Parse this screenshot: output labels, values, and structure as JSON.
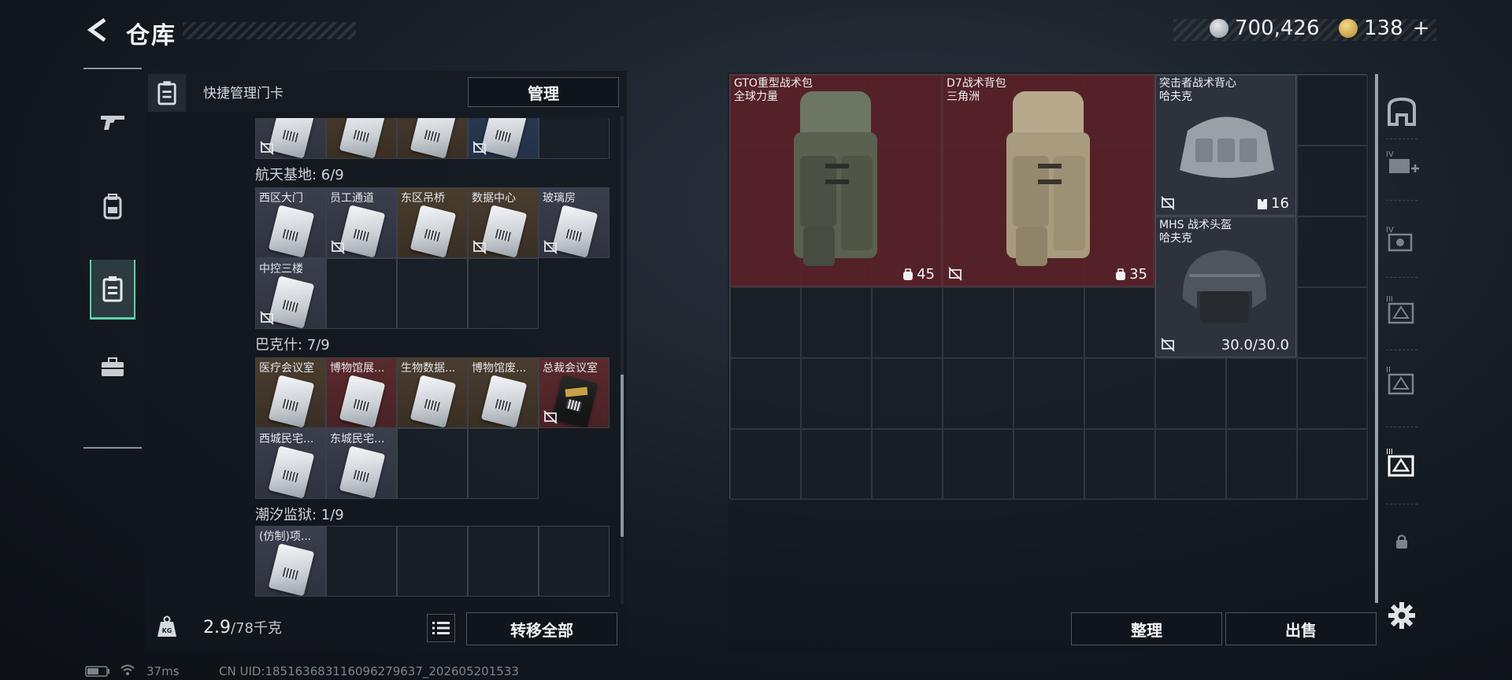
{
  "header": {
    "title": "仓库",
    "currency_1": "700,426",
    "currency_2": "138",
    "currency_2_plus": "+"
  },
  "left_panel": {
    "header_label": "快捷管理门卡",
    "manage_button": "管理",
    "sections": [
      {
        "title": "",
        "cells": [
          {
            "label": "",
            "color": "white",
            "nolink": true
          },
          {
            "label": "",
            "color": "gold",
            "nolink": false
          },
          {
            "label": "",
            "color": "gold",
            "nolink": false
          },
          {
            "label": "",
            "color": "blue",
            "nolink": true
          },
          {
            "empty": true
          }
        ]
      },
      {
        "title": "航天基地: 6/9",
        "cells": [
          {
            "label": "西区大门",
            "color": "white",
            "nolink": false
          },
          {
            "label": "员工通道",
            "color": "white",
            "nolink": true
          },
          {
            "label": "东区吊桥",
            "color": "gold",
            "nolink": false
          },
          {
            "label": "数据中心",
            "color": "gold",
            "nolink": true
          },
          {
            "label": "玻璃房",
            "color": "white",
            "nolink": true
          },
          {
            "label": "中控三楼",
            "color": "white",
            "nolink": true
          },
          {
            "empty": true
          },
          {
            "empty": true
          },
          {
            "empty": true
          }
        ]
      },
      {
        "title": "巴克什: 7/9",
        "cells": [
          {
            "label": "医疗会议室",
            "color": "gold",
            "nolink": false
          },
          {
            "label": "博物馆展...",
            "color": "red",
            "nolink": false
          },
          {
            "label": "生物数据...",
            "color": "gold",
            "nolink": false
          },
          {
            "label": "博物馆废...",
            "color": "gold",
            "nolink": false
          },
          {
            "label": "总裁会议室",
            "color": "red",
            "nolink": true,
            "dark": true
          },
          {
            "label": "西城民宅...",
            "color": "white",
            "nolink": false
          },
          {
            "label": "东城民宅...",
            "color": "white",
            "nolink": false
          },
          {
            "empty": true
          },
          {
            "empty": true
          }
        ]
      },
      {
        "title": "潮汐监狱: 1/9",
        "cells": [
          {
            "label": "(仿制)项...",
            "color": "white",
            "nolink": false
          },
          {
            "empty": true
          },
          {
            "empty": true
          },
          {
            "empty": true
          },
          {
            "empty": true
          }
        ]
      }
    ],
    "weight_value": "2.9",
    "weight_max": "/78千克",
    "transfer_all_button": "转移全部"
  },
  "stash": {
    "items": [
      {
        "name": "GTO重型战术包\n全球力量",
        "badge": "45",
        "badge_icon": "backpack-capacity-icon",
        "color": "red"
      },
      {
        "name": "D7战术背包\n三角洲",
        "badge": "35",
        "badge_icon": "backpack-capacity-icon",
        "color": "red"
      },
      {
        "name": "突击者战术背心\n哈夫克",
        "badge": "16",
        "badge_icon": "vest-capacity-icon",
        "color": "grey"
      },
      {
        "name": "MHS 战术头盔\n哈夫克",
        "badge": "30.0/30.0",
        "badge_icon": "",
        "color": "grey"
      }
    ],
    "sort_button": "整理",
    "sell_button": "出售"
  },
  "status_bar": {
    "ping": "37ms",
    "uid": "CN UID:18516368311609627963​7_202605201533"
  },
  "colors": {
    "accent": "#5fd0a8",
    "item_red": "#5a2228",
    "item_gold": "#4a3d2f"
  }
}
